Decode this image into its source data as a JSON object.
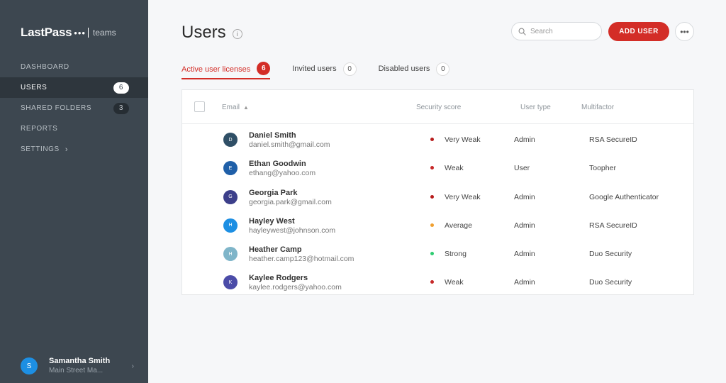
{
  "sidebar": {
    "logo_text": "LastPass",
    "logo_dots": "•••",
    "logo_sub": "teams",
    "nav": [
      {
        "label": "DASHBOARD",
        "badge": ""
      },
      {
        "label": "USERS",
        "badge": "6"
      },
      {
        "label": "SHARED FOLDERS",
        "badge": "3"
      },
      {
        "label": "REPORTS",
        "badge": ""
      },
      {
        "label": "SETTINGS",
        "badge": ""
      }
    ],
    "account": {
      "initial": "S",
      "name": "Samantha Smith",
      "sub": "Main Street Ma..."
    }
  },
  "header": {
    "title": "Users",
    "info": "i",
    "search_placeholder": "Search",
    "add_label": "ADD USER",
    "more_label": "•••"
  },
  "tabs": [
    {
      "label": "Active user licenses",
      "count": "6"
    },
    {
      "label": "Invited users",
      "count": "0"
    },
    {
      "label": "Disabled users",
      "count": "0"
    }
  ],
  "table": {
    "columns": {
      "email": "Email",
      "score": "Security score",
      "type": "User type",
      "mfa": "Multifactor"
    },
    "rows": [
      {
        "initial": "D",
        "name": "Daniel Smith",
        "email": "daniel.smith@gmail.com",
        "score": "Very Weak",
        "type": "Admin",
        "mfa": "RSA SecureID"
      },
      {
        "initial": "E",
        "name": "Ethan Goodwin",
        "email": "ethang@yahoo.com",
        "score": "Weak",
        "type": "User",
        "mfa": "Toopher"
      },
      {
        "initial": "G",
        "name": "Georgia Park",
        "email": "georgia.park@gmail.com",
        "score": "Very Weak",
        "type": "Admin",
        "mfa": "Google Authenticator"
      },
      {
        "initial": "H",
        "name": "Hayley West",
        "email": "hayleywest@johnson.com",
        "score": "Average",
        "type": "Admin",
        "mfa": "RSA SecureID"
      },
      {
        "initial": "H",
        "name": "Heather Camp",
        "email": "heather.camp123@hotmail.com",
        "score": "Strong",
        "type": "Admin",
        "mfa": "Duo Security"
      },
      {
        "initial": "K",
        "name": "Kaylee Rodgers",
        "email": "kaylee.rodgers@yahoo.com",
        "score": "Weak",
        "type": "Admin",
        "mfa": "Duo Security"
      }
    ]
  },
  "colors": {
    "accent": "#d32d27",
    "sidebar_bg": "#3d4750",
    "score_very_weak": "#b71c1c",
    "score_weak": "#c62828",
    "score_average": "#f0a030",
    "score_strong": "#2ecc71",
    "avatar_d": "#2f4f66",
    "avatar_e": "#1f5fa8",
    "avatar_g": "#3c3f8a",
    "avatar_h1": "#1d8fe3",
    "avatar_h2": "#7fb5c9",
    "avatar_k": "#4b4ca8"
  }
}
